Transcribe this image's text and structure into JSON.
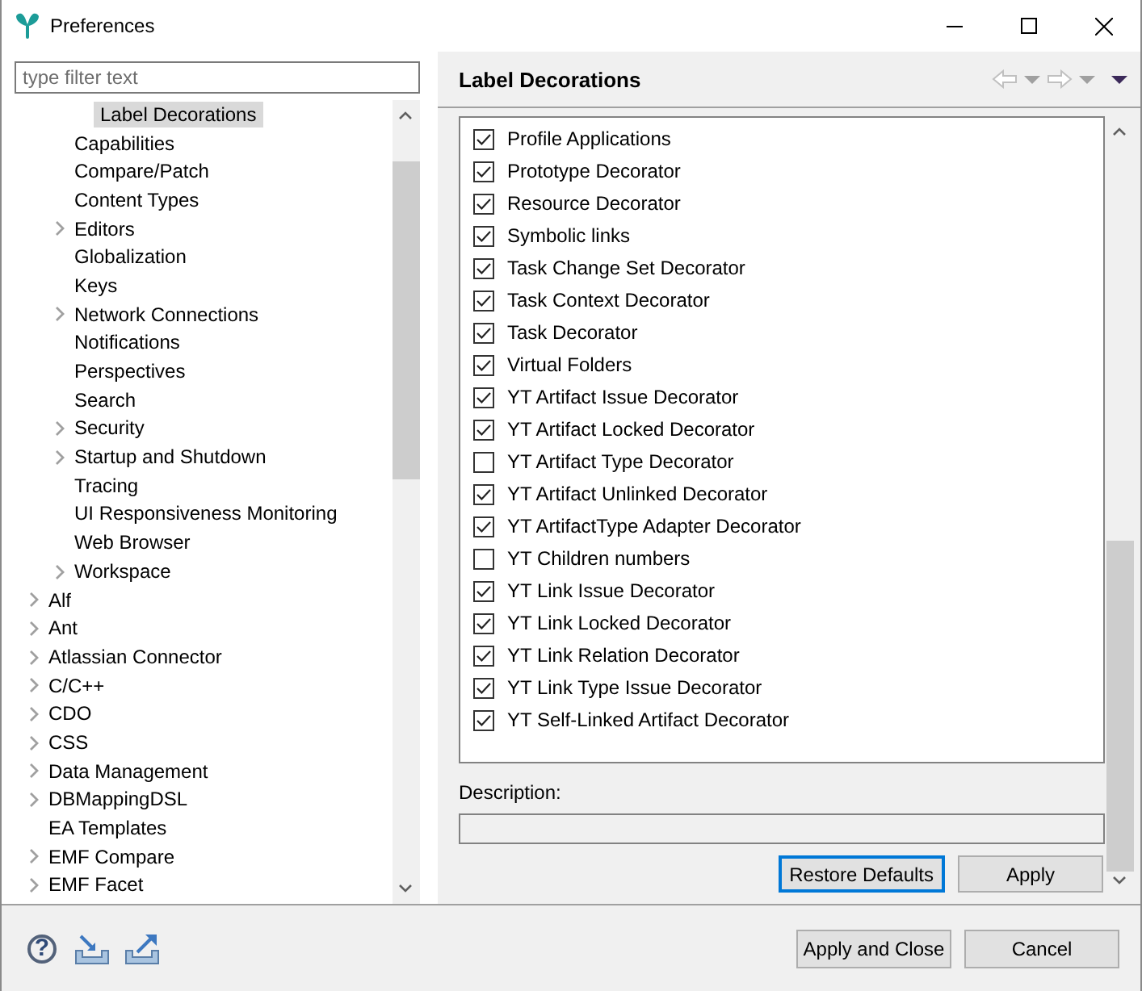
{
  "window": {
    "title": "Preferences"
  },
  "filter": {
    "placeholder": "type filter text"
  },
  "tree": {
    "items": [
      {
        "children": [
          {
            "children": [
              {
                "label": "Label Decorations",
                "expandable": false,
                "selected": true
              }
            ]
          },
          {
            "label": "Capabilities",
            "expandable": false,
            "selected": false
          },
          {
            "label": "Compare/Patch",
            "expandable": false,
            "selected": false
          },
          {
            "label": "Content Types",
            "expandable": false,
            "selected": false
          },
          {
            "label": "Editors",
            "expandable": true,
            "selected": false
          },
          {
            "label": "Globalization",
            "expandable": false,
            "selected": false
          },
          {
            "label": "Keys",
            "expandable": false,
            "selected": false
          },
          {
            "label": "Network Connections",
            "expandable": true,
            "selected": false
          },
          {
            "label": "Notifications",
            "expandable": false,
            "selected": false
          },
          {
            "label": "Perspectives",
            "expandable": false,
            "selected": false
          },
          {
            "label": "Search",
            "expandable": false,
            "selected": false
          },
          {
            "label": "Security",
            "expandable": true,
            "selected": false
          },
          {
            "label": "Startup and Shutdown",
            "expandable": true,
            "selected": false
          },
          {
            "label": "Tracing",
            "expandable": false,
            "selected": false
          },
          {
            "label": "UI Responsiveness Monitoring",
            "expandable": false,
            "selected": false
          },
          {
            "label": "Web Browser",
            "expandable": false,
            "selected": false
          },
          {
            "label": "Workspace",
            "expandable": true,
            "selected": false
          }
        ]
      },
      {
        "label": "Alf",
        "expandable": true,
        "selected": false
      },
      {
        "label": "Ant",
        "expandable": true,
        "selected": false
      },
      {
        "label": "Atlassian Connector",
        "expandable": true,
        "selected": false
      },
      {
        "label": "C/C++",
        "expandable": true,
        "selected": false
      },
      {
        "label": "CDO",
        "expandable": true,
        "selected": false
      },
      {
        "label": "CSS",
        "expandable": true,
        "selected": false
      },
      {
        "label": "Data Management",
        "expandable": true,
        "selected": false
      },
      {
        "label": "DBMappingDSL",
        "expandable": true,
        "selected": false
      },
      {
        "label": "EA Templates",
        "expandable": false,
        "selected": false
      },
      {
        "label": "EMF Compare",
        "expandable": true,
        "selected": false
      },
      {
        "label": "EMF Facet",
        "expandable": true,
        "selected": false
      }
    ]
  },
  "page": {
    "title": "Label Decorations",
    "decorators": [
      {
        "label": "Profile Applications",
        "checked": true
      },
      {
        "label": "Prototype Decorator",
        "checked": true
      },
      {
        "label": "Resource Decorator",
        "checked": true
      },
      {
        "label": "Symbolic links",
        "checked": true
      },
      {
        "label": "Task Change Set Decorator",
        "checked": true
      },
      {
        "label": "Task Context Decorator",
        "checked": true
      },
      {
        "label": "Task Decorator",
        "checked": true
      },
      {
        "label": "Virtual Folders",
        "checked": true
      },
      {
        "label": "YT Artifact Issue Decorator",
        "checked": true
      },
      {
        "label": "YT Artifact Locked Decorator",
        "checked": true
      },
      {
        "label": "YT Artifact Type Decorator",
        "checked": false
      },
      {
        "label": "YT Artifact Unlinked Decorator",
        "checked": true
      },
      {
        "label": "YT ArtifactType Adapter Decorator",
        "checked": true
      },
      {
        "label": "YT Children numbers",
        "checked": false
      },
      {
        "label": "YT Link Issue Decorator",
        "checked": true
      },
      {
        "label": "YT Link Locked Decorator",
        "checked": true
      },
      {
        "label": "YT Link Relation Decorator",
        "checked": true
      },
      {
        "label": "YT Link Type Issue Decorator",
        "checked": true
      },
      {
        "label": "YT Self-Linked Artifact Decorator",
        "checked": true
      }
    ],
    "description_label": "Description:",
    "buttons": [
      {
        "label": "Restore Defaults",
        "focused": true
      },
      {
        "label": "Apply",
        "focused": false
      }
    ]
  },
  "footer": {
    "help": "?",
    "buttons": [
      "Apply and Close",
      "Cancel"
    ]
  }
}
